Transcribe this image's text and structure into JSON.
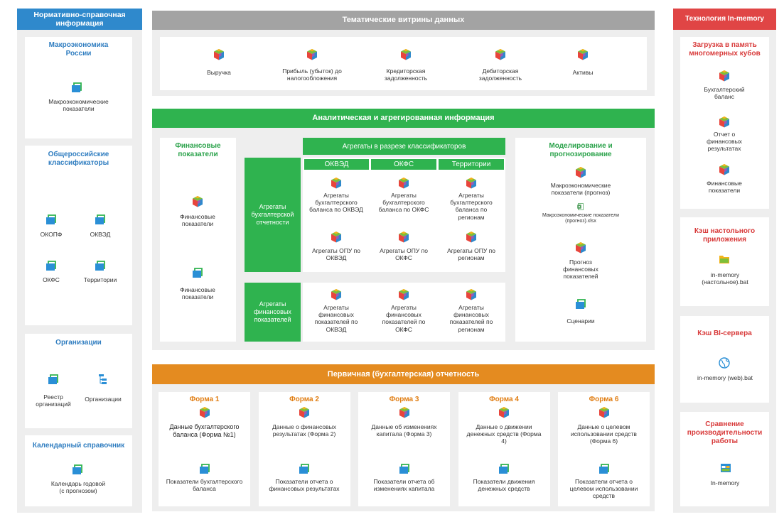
{
  "colors": {
    "blue": "#2f89cc",
    "gray": "#a3a3a3",
    "green": "#2fb34f",
    "orange": "#e48b20",
    "red": "#e04545",
    "panel": "#eeeeee"
  },
  "left": {
    "header": "Нормативно-справочная информация",
    "macro": {
      "title": "Макроэкономика России",
      "item": "Макроэкономические показатели"
    },
    "classifiers": {
      "title": "Общероссийские классификаторы",
      "items": [
        "ОКОПФ",
        "ОКВЭД",
        "ОКФС",
        "Территории"
      ]
    },
    "orgs": {
      "title": "Организации",
      "items": [
        "Реестр организаций",
        "Организации"
      ]
    },
    "calendar": {
      "title": "Календарный справочник",
      "item": "Календарь годовой (с прогнозом)"
    }
  },
  "showcases": {
    "header": "Тематические витрины данных",
    "items": [
      "Выручка",
      "Прибыль (убыток) до налогообложения",
      "Кредиторская задолженность",
      "Дебиторская задолженность",
      "Активы"
    ]
  },
  "analytics": {
    "header": "Аналитическая и агрегированная информация",
    "fin": {
      "title": "Финансовые показатели",
      "items": [
        "Финансовые показатели",
        "Финансовые показатели"
      ]
    },
    "aggregates": {
      "header": "Агрегаты в разрезе классификаторов",
      "columns": [
        "ОКВЭД",
        "ОКФС",
        "Территории"
      ],
      "row1_label": "Агрегаты бухгалтерской отчетности",
      "row1_balance": [
        "Агрегаты бухгалтерского баланса по ОКВЭД",
        "Агрегаты бухгалтерского баланса по ОКФС",
        "Агрегаты бухгалтерского баланса по регионам"
      ],
      "row1_opu": [
        "Агрегаты ОПУ по ОКВЭД",
        "Агрегаты ОПУ по ОКФС",
        "Агрегаты ОПУ по регионам"
      ],
      "row2_label": "Агрегаты финансовых показателей",
      "row2_items": [
        "Агрегаты финансовых показателей по ОКВЭД",
        "Агрегаты финансовых показателей по ОКФС",
        "Агрегаты финансовых показателей по регионам"
      ]
    },
    "modeling": {
      "title": "Моделирование и прогнозирование",
      "items": [
        "Макроэкономические показатели (прогноз)",
        "Макроэкономические показатели (прогноз).xlsx",
        "Прогноз финансовых показателей",
        "Сценарии"
      ]
    }
  },
  "primary": {
    "header": "Первичная (бухгалтерская) отчетность",
    "forms": [
      {
        "title": "Форма 1",
        "cube": "Данные бухгалтерского баланса (Форма №1)",
        "report": "Показатели бухгалтерского баланса"
      },
      {
        "title": "Форма 2",
        "cube": "Данные о финансовых результатах (Форма 2)",
        "report": "Показатели отчета о финансовых результатах"
      },
      {
        "title": "Форма 3",
        "cube": "Данные об изменениях капитала (Форма 3)",
        "report": "Показатели отчета об изменениях капитала"
      },
      {
        "title": "Форма 4",
        "cube": "Данные о движении денежных средств (Форма 4)",
        "report": "Показатели движения денежных средств"
      },
      {
        "title": "Форма 6",
        "cube": "Данные о целевом использовании средств (Форма 6)",
        "report": "Показатели отчета о целевом использовании средств"
      }
    ]
  },
  "right": {
    "header": "Технология In-memory",
    "load": {
      "title": "Загрузка в память многомерных кубов",
      "items": [
        "Бухгалтерский баланс",
        "Отчет о финансовых результатах",
        "Финансовые показатели"
      ]
    },
    "desktop": {
      "title": "Кэш настольного приложения",
      "item": "in-memory (настольное).bat"
    },
    "bi": {
      "title": "Кэш BI-сервера",
      "item": "in-memory (web).bat"
    },
    "perf": {
      "title": "Сравнение производительности работы",
      "item": "In-memory"
    }
  }
}
